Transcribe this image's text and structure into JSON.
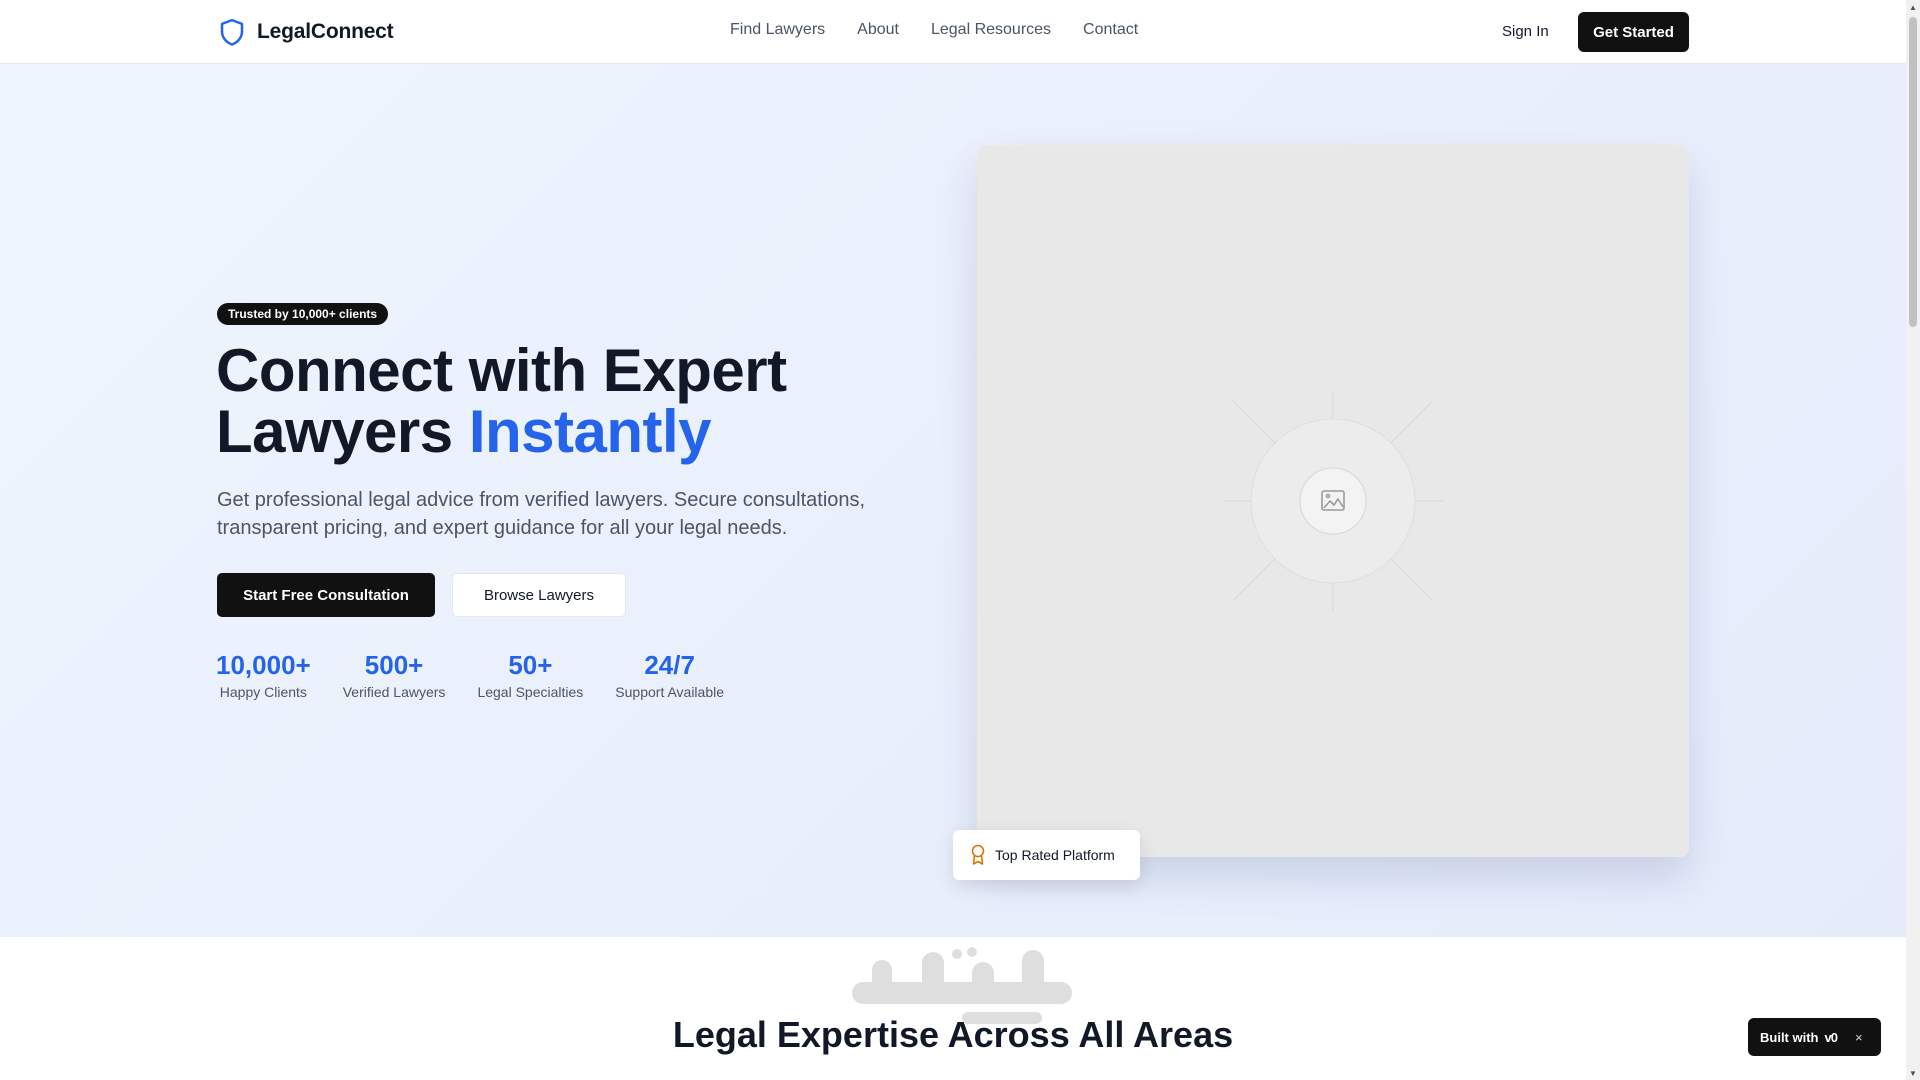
{
  "header": {
    "logo_text": "LegalConnect",
    "nav": [
      "Find Lawyers",
      "About",
      "Legal Resources",
      "Contact"
    ],
    "sign_in": "Sign In",
    "get_started": "Get Started"
  },
  "hero": {
    "badge": "Trusted by 10,000+ clients",
    "title_line1": "Connect with Expert",
    "title_line2_plain": "Lawyers",
    "title_line2_accent": "Instantly",
    "description": "Get professional legal advice from verified lawyers. Secure consultations, transparent pricing, and expert guidance for all your legal needs.",
    "primary_button": "Start Free Consultation",
    "secondary_button": "Browse Lawyers",
    "stats": [
      {
        "value": "10,000+",
        "label": "Happy Clients"
      },
      {
        "value": "500+",
        "label": "Verified Lawyers"
      },
      {
        "value": "50+",
        "label": "Legal Specialties"
      },
      {
        "value": "24/7",
        "label": "Support Available"
      }
    ],
    "image_icon": "image-placeholder-icon",
    "rated_badge": "Top Rated Platform",
    "rated_icon": "award-icon"
  },
  "section": {
    "title": "Legal Expertise Across All Areas"
  },
  "built_with": {
    "label": "Built with",
    "logo": "v0",
    "close": "×"
  },
  "colors": {
    "accent": "#2563eb",
    "dark": "#111111",
    "award": "#d97706"
  }
}
